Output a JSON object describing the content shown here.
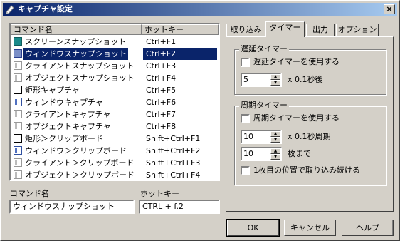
{
  "window": {
    "title": "キャプチャ設定",
    "close_label": "×"
  },
  "list": {
    "headers": {
      "command": "コマンド名",
      "hotkey": "ホットキー"
    },
    "rows": [
      {
        "name": "スクリーンスナップショット",
        "hotkey": "Ctrl+F1",
        "icon": "screen-icon"
      },
      {
        "name": "ウィンドウスナップショット",
        "hotkey": "Ctrl+F2",
        "icon": "window-icon"
      },
      {
        "name": "クライアントスナップショット",
        "hotkey": "Ctrl+F3",
        "icon": "client-icon"
      },
      {
        "name": "オブジェクトスナップショット",
        "hotkey": "Ctrl+F4",
        "icon": "object-icon"
      },
      {
        "name": "矩形キャプチャ",
        "hotkey": "Ctrl+F5",
        "icon": "rect-icon"
      },
      {
        "name": "ウィンドウキャプチャ",
        "hotkey": "Ctrl+F6",
        "icon": "window-capture-icon"
      },
      {
        "name": "クライアントキャプチャ",
        "hotkey": "Ctrl+F7",
        "icon": "client-icon"
      },
      {
        "name": "オブジェクトキャプチャ",
        "hotkey": "Ctrl+F8",
        "icon": "object-icon"
      },
      {
        "name": "矩形＞クリップボード",
        "hotkey": "Shift+Ctrl+F1",
        "icon": "rect-icon"
      },
      {
        "name": "ウィンドウ＞クリップボード",
        "hotkey": "Shift+Ctrl+F2",
        "icon": "window-capture-icon"
      },
      {
        "name": "クライアント＞クリップボード",
        "hotkey": "Shift+Ctrl+F3",
        "icon": "client-icon"
      },
      {
        "name": "オブジェクト＞クリップボード",
        "hotkey": "Shift+Ctrl+F4",
        "icon": "object-icon"
      }
    ],
    "selected_index": 1
  },
  "editor": {
    "command_label": "コマンド名",
    "command_value": "ウィンドウスナップショット",
    "hotkey_label": "ホットキー",
    "hotkey_value": "CTRL + f.2"
  },
  "tabs": [
    {
      "label": "取り込み",
      "active": false
    },
    {
      "label": "タイマー",
      "active": true
    },
    {
      "label": "出力",
      "active": false
    },
    {
      "label": "オプション",
      "active": false
    }
  ],
  "delay_timer": {
    "title": "遅延タイマー",
    "use_label": "遅延タイマーを使用する",
    "use_checked": false,
    "value": "5",
    "unit": "x 0.1秒後"
  },
  "periodic_timer": {
    "title": "周期タイマー",
    "use_label": "周期タイマーを使用する",
    "use_checked": false,
    "period_value": "10",
    "period_unit": "x 0.1秒周期",
    "count_value": "10",
    "count_unit": "枚まで",
    "same_pos_label": "1枚目の位置で取り込み続ける",
    "same_pos_checked": false
  },
  "buttons": {
    "ok": "OK",
    "cancel": "キャンセル",
    "help": "ヘルプ"
  },
  "colors": {
    "title_start": "#0a246a",
    "title_end": "#a6caf0",
    "face": "#d4d0c8",
    "selection": "#0a246a"
  }
}
